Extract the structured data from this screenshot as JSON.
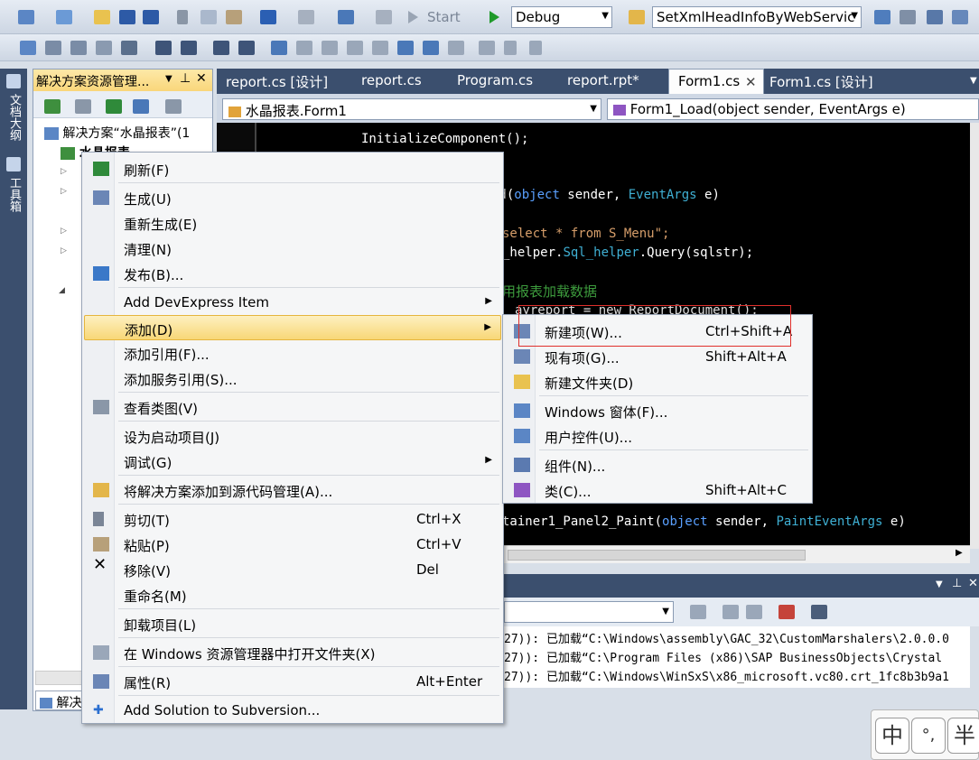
{
  "toolbar": {
    "start_label": "Start",
    "config_value": "Debug",
    "find_value": "SetXmlHeadInfoByWebServic"
  },
  "left_strip": {
    "tab1": "文档大纲",
    "tab2": "工具箱"
  },
  "solution_explorer": {
    "title": "解决方案资源管理...",
    "solution_label": "解决方案“水晶报表”(1",
    "project_label": "水晶报表",
    "bottom_tab": "解决"
  },
  "editor": {
    "tabs": [
      "report.cs [设计]",
      "report.cs",
      "Program.cs",
      "report.rpt*",
      "Form1.cs",
      "Form1.cs [设计]"
    ],
    "active_tab": "Form1.cs",
    "class_combo": "水晶报表.Form1",
    "member_combo": "Form1_Load(object sender, EventArgs e)",
    "code": {
      "l1": "InitializeComponent();",
      "l2a": "ad(",
      "l2b": "object",
      "l2c": " sender, ",
      "l2d": "EventArgs",
      "l2e": " e)",
      "l3": "select * from S_Menu\";",
      "l4a": "_helper.",
      "l4b": "Sql_helper",
      "l4c": ".Query(sqlstr);",
      "l5": "用报表加载数据",
      "l6": "ayreport = new ReportDocument();",
      "l7a": "tainer1_Panel2_Paint(",
      "l7b": "object",
      "l7c": " sender, ",
      "l7d": "PaintEventArgs",
      "l7e": " e)"
    }
  },
  "output": {
    "line1": "27)): 已加载“C:\\Windows\\assembly\\GAC_32\\CustomMarshalers\\2.0.0.0",
    "line2": "27)): 已加载“C:\\Program Files (x86)\\SAP BusinessObjects\\Crystal",
    "line3": "27)): 已加载“C:\\Windows\\WinSxS\\x86_microsoft.vc80.crt_1fc8b3b9a1"
  },
  "context_menu": {
    "items": [
      {
        "label": "刷新(F)",
        "icon": "refresh-icon"
      },
      {
        "label": "生成(U)",
        "icon": "build-icon"
      },
      {
        "label": "重新生成(E)"
      },
      {
        "label": "清理(N)"
      },
      {
        "label": "发布(B)...",
        "icon": "publish-icon"
      },
      {
        "label": "Add DevExpress Item"
      },
      {
        "label": "添加(D)"
      },
      {
        "label": "添加引用(F)..."
      },
      {
        "label": "添加服务引用(S)..."
      },
      {
        "label": "查看类图(V)",
        "icon": "class-diagram-icon"
      },
      {
        "label": "设为启动项目(J)"
      },
      {
        "label": "调试(G)"
      },
      {
        "label": "将解决方案添加到源代码管理(A)...",
        "icon": "source-control-icon"
      },
      {
        "label": "剪切(T)",
        "shortcut": "Ctrl+X",
        "icon": "cut-icon"
      },
      {
        "label": "粘贴(P)",
        "shortcut": "Ctrl+V",
        "icon": "paste-icon"
      },
      {
        "label": "移除(V)",
        "shortcut": "Del",
        "icon": "remove-icon"
      },
      {
        "label": "重命名(M)"
      },
      {
        "label": "卸载项目(L)"
      },
      {
        "label": "在 Windows 资源管理器中打开文件夹(X)",
        "icon": "open-folder-icon"
      },
      {
        "label": "属性(R)",
        "shortcut": "Alt+Enter",
        "icon": "properties-icon"
      },
      {
        "label": "Add Solution to Subversion...",
        "icon": "subversion-icon"
      }
    ]
  },
  "submenu": {
    "items": [
      {
        "label": "新建项(W)...",
        "shortcut": "Ctrl+Shift+A",
        "icon": "new-item-icon"
      },
      {
        "label": "现有项(G)...",
        "shortcut": "Shift+Alt+A",
        "icon": "existing-item-icon"
      },
      {
        "label": "新建文件夹(D)",
        "icon": "new-folder-icon"
      },
      {
        "label": "Windows 窗体(F)...",
        "icon": "windows-form-icon"
      },
      {
        "label": "用户控件(U)...",
        "icon": "user-control-icon"
      },
      {
        "label": "组件(N)...",
        "icon": "component-icon"
      },
      {
        "label": "类(C)...",
        "shortcut": "Shift+Alt+C",
        "icon": "class-icon"
      }
    ]
  },
  "ime": {
    "mode": "中",
    "punct": "°,",
    "width": "半"
  }
}
